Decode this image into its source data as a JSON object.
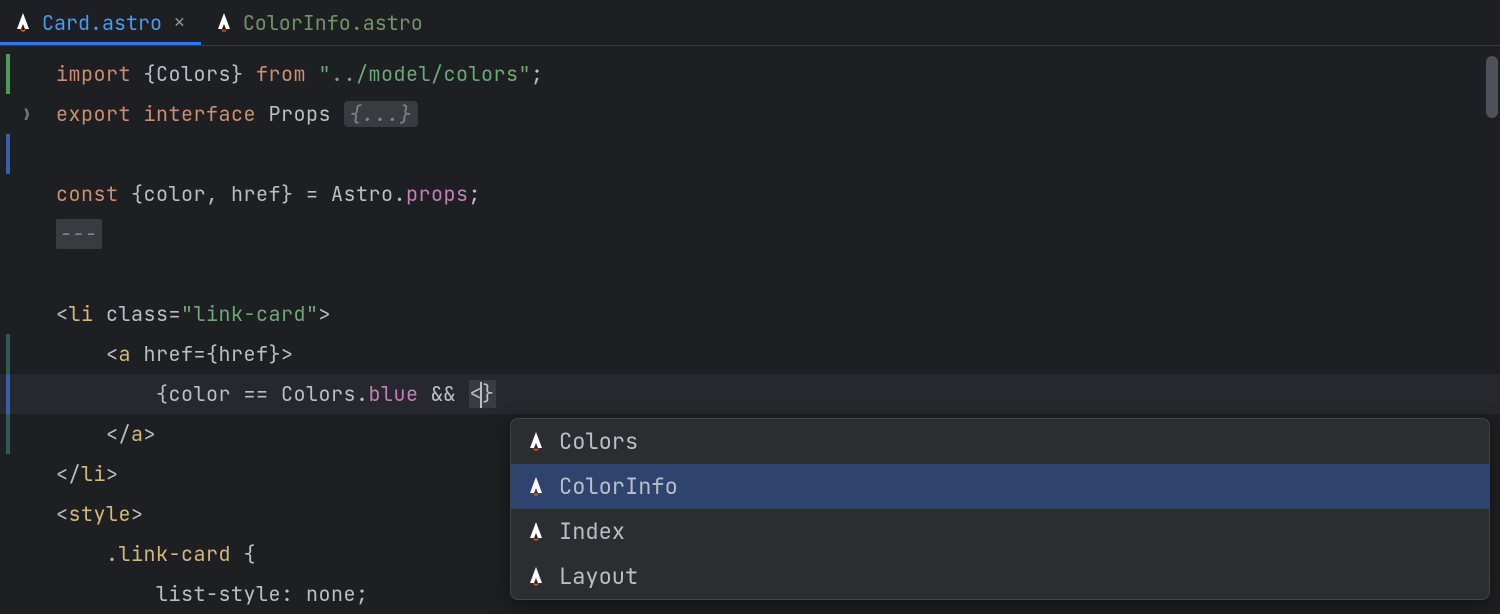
{
  "tabs": [
    {
      "label": "Card.astro",
      "active": true,
      "closable": true
    },
    {
      "label": "ColorInfo.astro",
      "active": false,
      "closable": false
    }
  ],
  "code": {
    "import_kw": "import",
    "import_name": "Colors",
    "from_kw": "from",
    "import_path": "\"../model/colors\"",
    "export_kw": "export",
    "interface_kw": "interface",
    "interface_name": "Props",
    "fold_text": "{...}",
    "const_kw": "const",
    "destruct": "{color, href}",
    "eq": " = ",
    "astro": "Astro",
    "dot": ".",
    "props": "props",
    "semi": ";",
    "front_dash": "---",
    "li_open_1": "<",
    "li_tag": "li",
    "li_space": " ",
    "li_attr": "class",
    "li_eq": "=",
    "li_val": "\"link-card\"",
    "tag_close": ">",
    "a_open_1": "<",
    "a_tag": "a",
    "a_space": " ",
    "a_attr": "href",
    "a_expr": "={href}>",
    "expr_open": "{",
    "expr_color": "color",
    "expr_eqeq": " == ",
    "expr_colors": "Colors",
    "expr_dot": ".",
    "expr_blue": "blue",
    "expr_and": " && ",
    "expr_lt": "<",
    "expr_close": "}",
    "a_close": "</a>",
    "a_close_tag": "a",
    "li_close": "</li>",
    "li_close_tag": "li",
    "style_open": "<style>",
    "style_tag": "style",
    "css_sel": ".link-card",
    "css_brace": " {",
    "css_prop": "list-style",
    "css_colon": ": ",
    "css_val": "none",
    "css_semi": ";"
  },
  "completion": {
    "items": [
      {
        "label": "Colors",
        "selected": false
      },
      {
        "label": "ColorInfo",
        "selected": true
      },
      {
        "label": "Index",
        "selected": false
      },
      {
        "label": "Layout",
        "selected": false
      }
    ]
  }
}
